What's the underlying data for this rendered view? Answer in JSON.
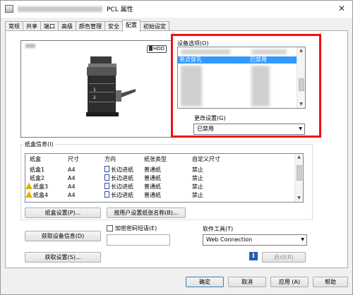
{
  "window": {
    "title": "PCL 属性",
    "close_glyph": "✕"
  },
  "tabs": [
    "常规",
    "共享",
    "端口",
    "高级",
    "颜色管理",
    "安全",
    "配置",
    "初始设定"
  ],
  "active_tab": "配置",
  "preview": {
    "hdd_label": "HDD",
    "device_numbers": [
      "1",
      "2"
    ]
  },
  "device_options": {
    "label": "设备选项(O)",
    "selected_row": {
      "name": "单点穿孔",
      "value": "已禁用"
    },
    "change_setting_label": "更改设置(G)",
    "change_setting_value": "已禁用"
  },
  "tray_info": {
    "label": "纸盒信息(I)",
    "headers": [
      "纸盒",
      "尺寸",
      "方向",
      "纸张类型",
      "自定义尺寸"
    ],
    "rows": [
      {
        "tray": "纸盒1",
        "size": "A4",
        "orientation": "长边进纸",
        "type": "普通纸",
        "custom": "禁止",
        "warning": false
      },
      {
        "tray": "纸盒2",
        "size": "A4",
        "orientation": "长边进纸",
        "type": "普通纸",
        "custom": "禁止",
        "warning": false
      },
      {
        "tray": "纸盒3",
        "size": "A4",
        "orientation": "长边进纸",
        "type": "普通纸",
        "custom": "禁止",
        "warning": true
      },
      {
        "tray": "纸盒4",
        "size": "A4",
        "orientation": "长边进纸",
        "type": "普通纸",
        "custom": "禁止",
        "warning": true
      }
    ],
    "tray_settings_button": "纸盒设置(P)...",
    "user_paper_button": "按用户设置纸张名称(B)..."
  },
  "device_info_button": "获取设备信息(D)",
  "get_settings_button": "获取设置(S)...",
  "encrypt": {
    "label": "加密密码短语(E)",
    "checked": false,
    "value": ""
  },
  "software_tools": {
    "label": "软件工具(T)",
    "value": "Web Connection",
    "launch_button": "启动(R)"
  },
  "footer": {
    "ok": "确定",
    "cancel": "取消",
    "apply": "应用 (A)",
    "help": "帮助"
  }
}
